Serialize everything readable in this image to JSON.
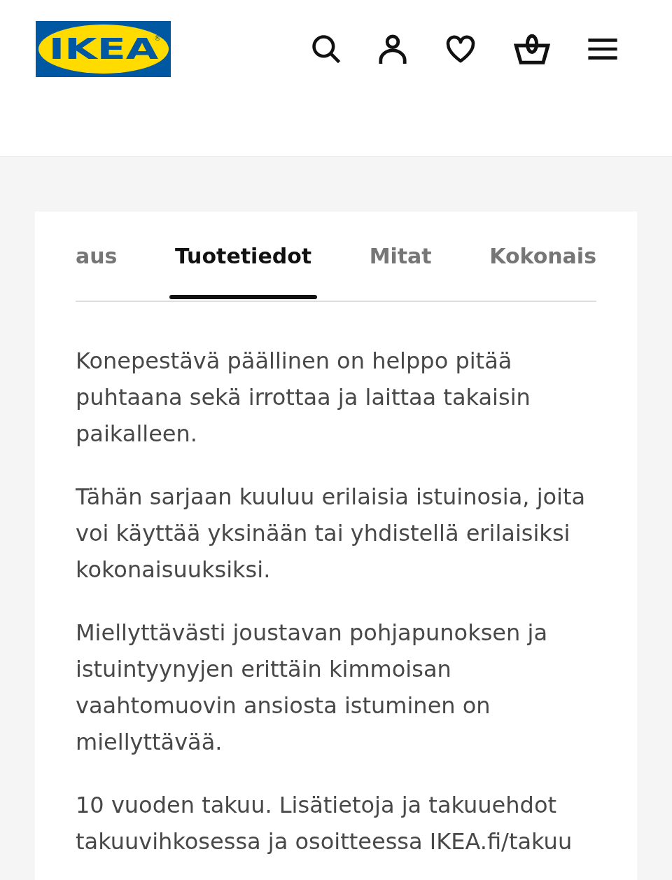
{
  "header": {
    "logo": {
      "wordmark": "IKEA",
      "registered_mark": "®"
    }
  },
  "tabs": [
    {
      "label": "aus",
      "selected": false
    },
    {
      "label": "Tuotetiedot",
      "selected": true
    },
    {
      "label": "Mitat",
      "selected": false
    },
    {
      "label": "Kokonais",
      "selected": false
    }
  ],
  "tab_panel": {
    "paragraphs": [
      "Konepestävä päällinen on helppo pitää puhtaana sekä irrottaa ja laittaa takaisin paikalleen.",
      "Tähän sarjaan kuuluu erilaisia istuinosia, joita voi käyttää yksinään tai yhdistellä erilaisiksi kokonaisuuksiksi.",
      "Miellyttävästi joustavan pohjapunoksen ja istuintyynyjen erittäin kimmoisan vaahtomuovin ansiosta istuminen on miellyttävää.",
      "10 vuoden takuu. Lisätietoja ja takuuehdot takuuvihkosessa ja osoitteessa IKEA.fi/takuu"
    ]
  }
}
